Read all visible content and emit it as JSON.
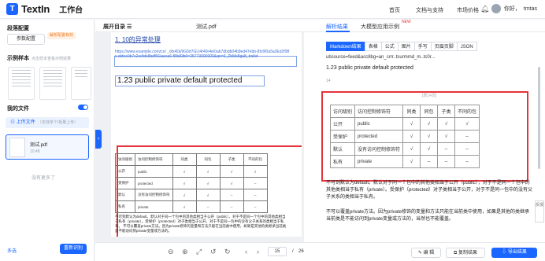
{
  "header": {
    "logo_mark": "T",
    "logo_text": "TextIn",
    "workspace": "工作台",
    "nav": [
      "首页",
      "文档与支持",
      "市场价格"
    ],
    "greeting": "你好，",
    "username": "tmtas"
  },
  "left": {
    "section_params": "段落配置",
    "param_button": "参数配置",
    "param_tag": "解析配置有效",
    "section_samples": "示例样本",
    "sample_note": "点击样本查看示例效果",
    "section_files": "我的文件",
    "upload_label": "上传文件",
    "upload_hint": "（支持单个/批量上传）",
    "file": {
      "name": "测试.pdf",
      "time": "10:48"
    },
    "empty_note": "没有更多了",
    "multi_select": "多选",
    "reparse_button": "重新识别"
  },
  "middle": {
    "toc_label": "展开目录",
    "file_name": "测试.pdf",
    "collapse_icon": "‹",
    "page": {
      "heading": "1. 10的异常处理",
      "link": "https://www.example.com/cn/ _dtx4Dj/9G0d7GLt4r40r4e/0ab7dbdb04b9ed47ebb-8fc6f0a5a3Ed2f98x.cbfec0b7c2cr/bfc8bdf56/aeca6-f8lid0lb0=25773000000&qn=0_ZbMs8ga8_trollxt",
      "h3": "1.23 public private default protected",
      "table": {
        "headers": [
          "访问级别",
          "访问控制修饰符",
          "同类",
          "同包",
          "子类",
          "不同的包"
        ],
        "rows": [
          [
            "公开",
            "public",
            "√",
            "√",
            "√",
            "√"
          ],
          [
            "受保护",
            "protected",
            "√",
            "√",
            "√",
            "--"
          ],
          [
            "默认",
            "没有访问控制修饰符",
            "√",
            "√",
            "--",
            "--"
          ],
          [
            "私有",
            "private",
            "√",
            "--",
            "--",
            "--"
          ]
        ]
      },
      "para1": "不可到默认为default。默认对于同一个包中的其他类相当于公开（public），对于不是同一个包中的其他类相当于私有（private）。受保护（protected）对子类相当于公开，对于不是同一包中的没有父子关系的类相当于私有。",
      "para2": "不可以覆盖private方法。因为private修饰的变量和方法只能在当前类中使用，如果是其他的类继承当前类是不能访问到private变量或方法的。"
    },
    "footer": {
      "zoom_out_icon": "⊖",
      "zoom_in_icon": "⊕",
      "fit_icon": "⤢",
      "rotate_left_icon": "↺",
      "rotate_right_icon": "↻",
      "prev_icon": "‹",
      "next_icon": "›",
      "current_page": "15",
      "separator": "/",
      "total_pages": "26"
    }
  },
  "right": {
    "tabs": [
      "解析结果",
      "大模型应用示例"
    ],
    "new_badge": "NEW",
    "subtabs": [
      "Markdown结果",
      "表格",
      "公式",
      "图片",
      "手写",
      "页眉页脚",
      "JSON"
    ],
    "line1": "ubsource=feed&acc8bg=an_crrr..tsurmmd_m..tc0r...",
    "h3": "1.23 public private default protected",
    "small": "14",
    "caption": "[表14页]",
    "table": {
      "headers": [
        "访问级别",
        "访问控制修饰符",
        "同类",
        "同包",
        "子类",
        "不同的包"
      ],
      "rows": [
        [
          "公开",
          "public",
          "√",
          "√",
          "√",
          "√"
        ],
        [
          "受保护",
          "protected",
          "√",
          "√",
          "√",
          "--"
        ],
        [
          "默认",
          "没有访问控制修饰符",
          "√",
          "√",
          "--",
          "--"
        ],
        [
          "私有",
          "private",
          "√",
          "--",
          "--",
          "--"
        ]
      ]
    },
    "para1": "不可到默认为default。默认对于同一个包中的其他类相当于公开（public），对于不是同一个包中的其他类相当于私有（private）。受保护（protected）对子类相当于公开，对于不是同一包中的没有父子关系的类相当于私有。",
    "para2": "不可以覆盖private方法。因为private修饰的变量和方法只能在当前类中使用，如果是其他的类继承当前类是不能访问到private变量或方法的，当然也不能覆盖。",
    "buttons": {
      "edit": "编 辑",
      "copy": "复制结果",
      "export": "导出结果"
    }
  },
  "feedback": "反馈",
  "colors": {
    "accent": "#1a66ff",
    "highlight": "#e5333b"
  }
}
